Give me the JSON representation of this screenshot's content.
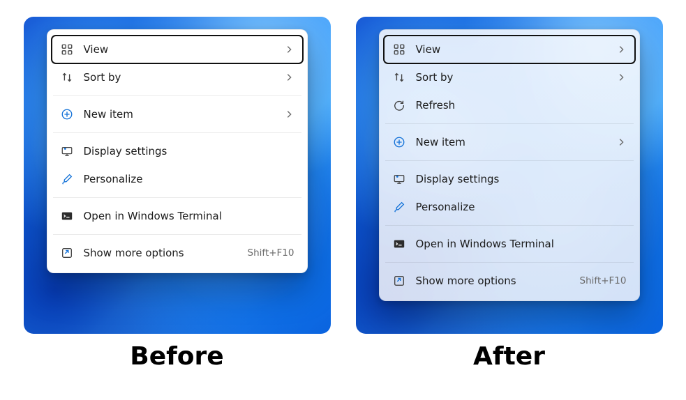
{
  "captions": {
    "before": "Before",
    "after": "After"
  },
  "before_menu": {
    "view": "View",
    "sort_by": "Sort by",
    "new_item": "New item",
    "display_settings": "Display settings",
    "personalize": "Personalize",
    "open_terminal": "Open in Windows Terminal",
    "show_more": "Show more options",
    "show_more_shortcut": "Shift+F10"
  },
  "after_menu": {
    "view": "View",
    "sort_by": "Sort by",
    "refresh": "Refresh",
    "new_item": "New item",
    "display_settings": "Display settings",
    "personalize": "Personalize",
    "open_terminal": "Open in Windows Terminal",
    "show_more": "Show more options",
    "show_more_shortcut": "Shift+F10"
  }
}
